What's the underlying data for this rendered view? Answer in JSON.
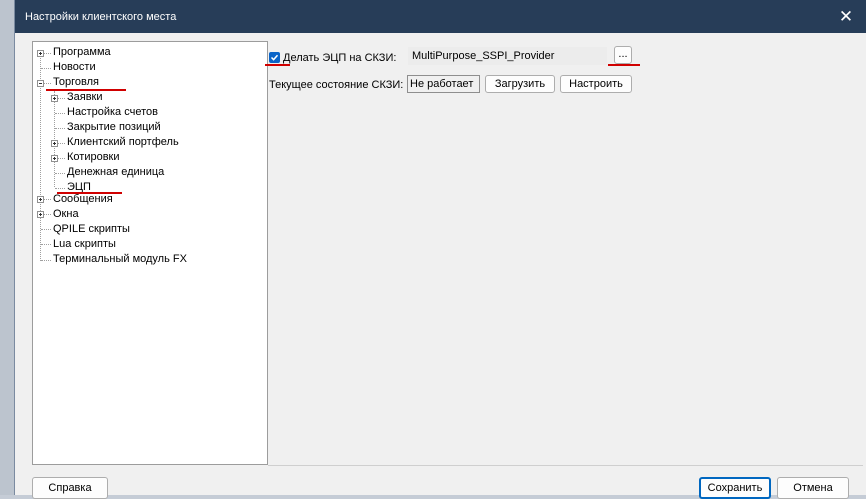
{
  "window": {
    "title": "Настройки клиентского места",
    "close_glyph": "✕"
  },
  "tree": {
    "items": [
      {
        "label": "Программа",
        "expandable": true,
        "expanded": false
      },
      {
        "label": "Новости",
        "expandable": false
      },
      {
        "label": "Торговля",
        "expandable": true,
        "expanded": true
      },
      {
        "label": "Заявки",
        "expandable": true,
        "expanded": false
      },
      {
        "label": "Настройка счетов",
        "expandable": false
      },
      {
        "label": "Закрытие позиций",
        "expandable": false
      },
      {
        "label": "Клиентский портфель",
        "expandable": true,
        "expanded": false
      },
      {
        "label": "Котировки",
        "expandable": true,
        "expanded": false
      },
      {
        "label": "Денежная единица",
        "expandable": false
      },
      {
        "label": "ЭЦП",
        "expandable": false,
        "selected": true
      },
      {
        "label": "Сообщения",
        "expandable": true,
        "expanded": false
      },
      {
        "label": "Окна",
        "expandable": true,
        "expanded": false
      },
      {
        "label": "QPILE скрипты",
        "expandable": false
      },
      {
        "label": "Lua скрипты",
        "expandable": false
      },
      {
        "label": "Терминальный модуль FX",
        "expandable": false
      }
    ]
  },
  "settings": {
    "sign_checkbox_label": "Делать ЭЦП на СКЗИ:",
    "sign_checked": true,
    "provider_value": "MultiPurpose_SSPI_Provider",
    "browse_label": "...",
    "status_label": "Текущее состояние СКЗИ:",
    "status_value": "Не работает",
    "load_button": "Загрузить",
    "configure_button": "Настроить"
  },
  "footer": {
    "help_button": "Справка",
    "save_button": "Сохранить",
    "cancel_button": "Отмена"
  },
  "colors": {
    "titlebar": "#273d58",
    "accent": "#0067c0",
    "annotation_underline": "#d00000"
  }
}
